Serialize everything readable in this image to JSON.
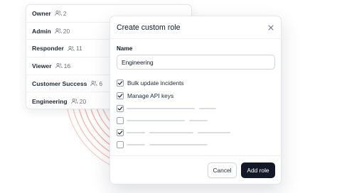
{
  "roles": [
    {
      "name": "Owner",
      "count": "2"
    },
    {
      "name": "Admin",
      "count": "20"
    },
    {
      "name": "Responder",
      "count": "11"
    },
    {
      "name": "Viewer",
      "count": "16"
    },
    {
      "name": "Customer Success",
      "count": "6"
    },
    {
      "name": "Engineering",
      "count": "20"
    }
  ],
  "modal": {
    "title": "Create custom role",
    "name_label": "Name",
    "name_value": "Engineering",
    "permissions": [
      {
        "label": "Bulk update incidents",
        "checked": true
      },
      {
        "label": "Manage API keys",
        "checked": true
      }
    ],
    "placeholder_rows_checked": [
      true,
      false,
      true,
      false
    ],
    "cancel_label": "Cancel",
    "add_label": "Add role"
  },
  "colors": {
    "ripple": "#f07e6a",
    "primary_button": "#111827"
  },
  "icons": [
    "users-icon",
    "close-icon",
    "check-icon"
  ]
}
